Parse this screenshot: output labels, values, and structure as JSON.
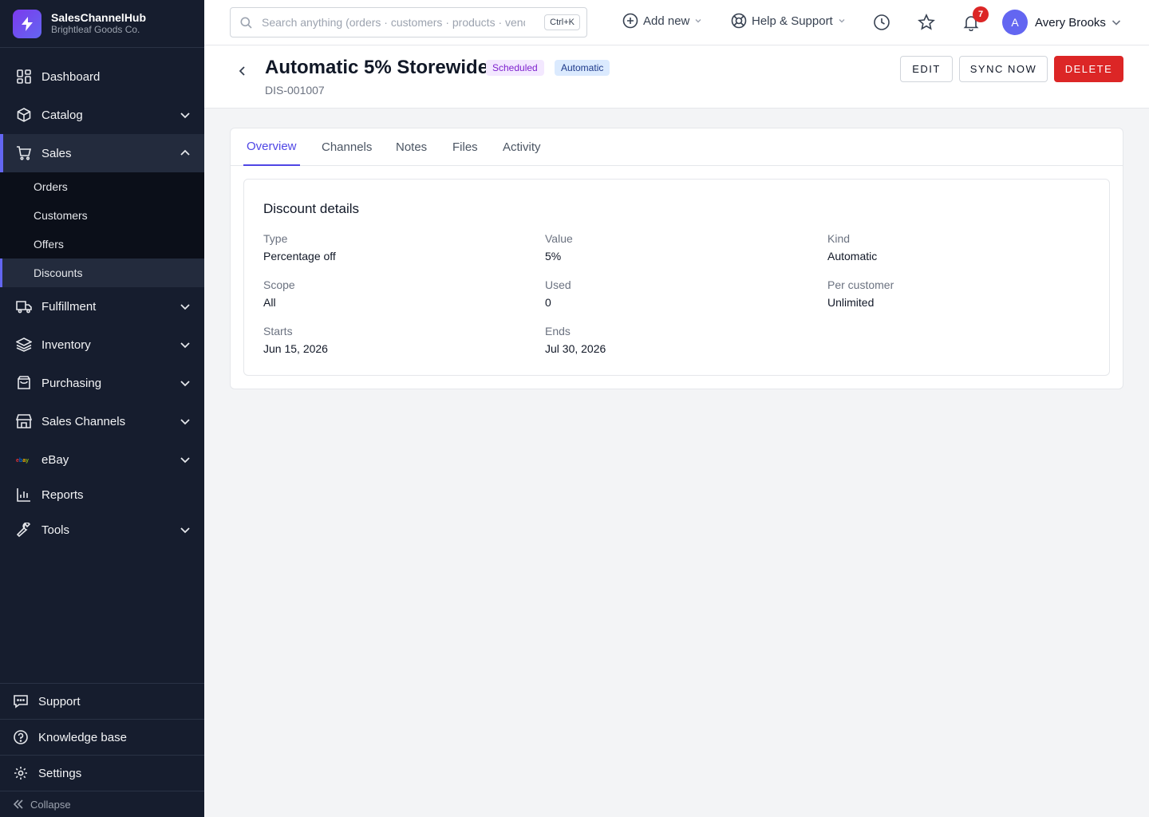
{
  "brand": {
    "name": "SalesChannelHub",
    "org": "Brightleaf Goods Co."
  },
  "nav": {
    "dashboard": "Dashboard",
    "catalog": "Catalog",
    "sales": "Sales",
    "sales_sub": [
      "Orders",
      "Customers",
      "Offers",
      "Discounts"
    ],
    "fulfillment": "Fulfillment",
    "inventory": "Inventory",
    "purchasing": "Purchasing",
    "sales_channels": "Sales Channels",
    "ebay": "eBay",
    "ebay_logo": "ebay",
    "reports": "Reports",
    "tools": "Tools"
  },
  "bottom": {
    "support": "Support",
    "knowledge": "Knowledge base",
    "settings": "Settings",
    "collapse": "Collapse"
  },
  "topbar": {
    "search_placeholder": "Search anything (orders · customers · products · vendors)",
    "search_shortcut": "Ctrl+K",
    "add_new": "Add new",
    "help": "Help & Support",
    "notifications_count": "7",
    "user_initial": "A",
    "user_name": "Avery Brooks"
  },
  "header": {
    "title": "Automatic 5% Storewide",
    "status": "Scheduled",
    "kind_badge": "Automatic",
    "id": "DIS-001007",
    "edit": "EDIT",
    "sync": "SYNC NOW",
    "delete": "DELETE"
  },
  "tabs": [
    "Overview",
    "Channels",
    "Notes",
    "Files",
    "Activity"
  ],
  "details": {
    "title": "Discount details",
    "type_label": "Type",
    "type_value": "Percentage off",
    "value_label": "Value",
    "value_value": "5%",
    "kind_label": "Kind",
    "kind_value": "Automatic",
    "scope_label": "Scope",
    "scope_value": "All",
    "used_label": "Used",
    "used_value": "0",
    "per_customer_label": "Per customer",
    "per_customer_value": "Unlimited",
    "starts_label": "Starts",
    "starts_value": "Jun 15, 2026",
    "ends_label": "Ends",
    "ends_value": "Jul 30, 2026"
  },
  "colors": {
    "accent": "#6366f1",
    "danger": "#dc2626",
    "sidebar": "#161d2e"
  }
}
